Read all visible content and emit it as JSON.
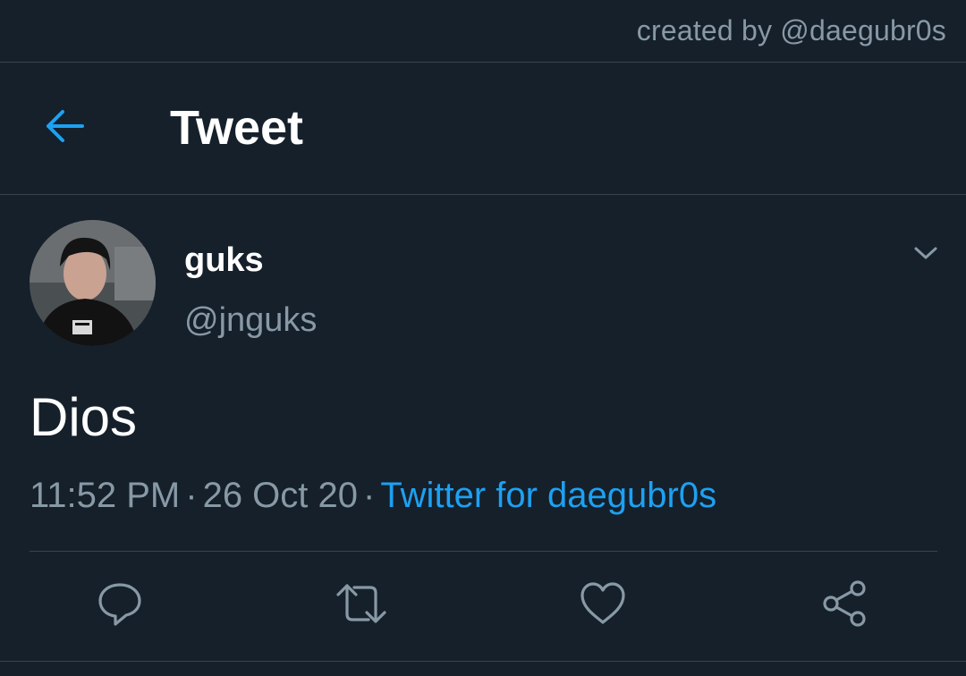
{
  "credit": {
    "text": "created by @daegubr0s"
  },
  "header": {
    "title": "Tweet",
    "back_icon": "arrow-left-icon"
  },
  "tweet": {
    "author": {
      "name": "guks",
      "handle": "@jnguks"
    },
    "text": "Dios",
    "time": "11:52 PM",
    "date": "26 Oct 20",
    "separator": "·",
    "source": "Twitter for daegubr0s"
  },
  "actions": [
    {
      "name": "reply",
      "icon": "reply-icon"
    },
    {
      "name": "retweet",
      "icon": "retweet-icon"
    },
    {
      "name": "like",
      "icon": "heart-icon"
    },
    {
      "name": "share",
      "icon": "share-icon"
    }
  ],
  "colors": {
    "background": "#15202b",
    "accent": "#1da1f2",
    "muted": "#8899a6",
    "border": "#38444d"
  }
}
